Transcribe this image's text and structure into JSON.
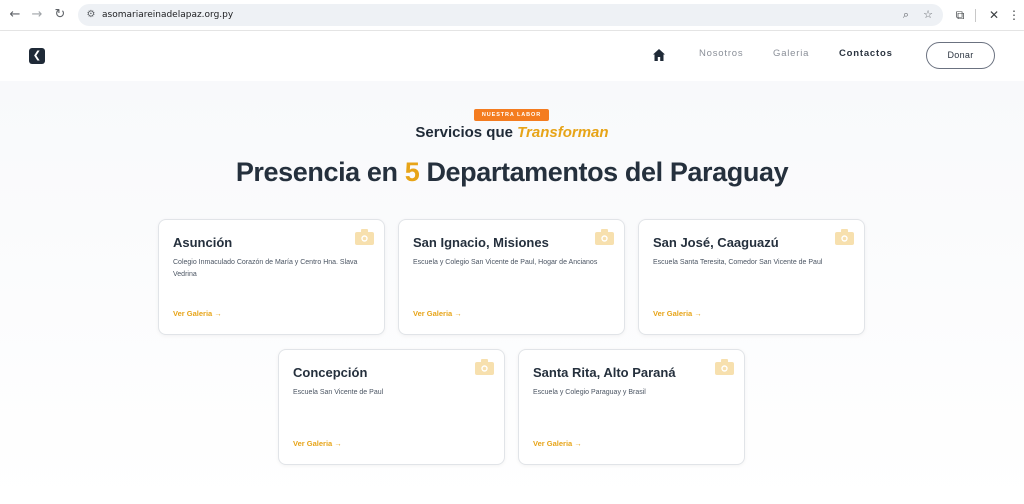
{
  "browser": {
    "url": "asomariareinadelapaz.org.py",
    "back_icon": "arrow-left-icon",
    "forward_icon": "arrow-right-icon",
    "reload_icon": "reload-icon"
  },
  "header": {
    "logo_glyph": "❮",
    "nav": {
      "nosotros": "Nosotros",
      "galeria": "Galeria",
      "contactos": "Contactos"
    },
    "donate_label": "Donar"
  },
  "section": {
    "badge": "NUESTRA LABOR",
    "subtitle_prefix": "Servicios que ",
    "subtitle_accent": "Transforman",
    "title_prefix": "Presencia en ",
    "title_number": "5",
    "title_suffix": " Departamentos del Paraguay"
  },
  "colors": {
    "accent": "#e7a418",
    "badge": "#f47c20",
    "dark": "#25303d"
  },
  "cards": [
    {
      "title": "Asunción",
      "description": "Colegio Inmaculado Corazón de María y Centro Hna. Slava Vedrina",
      "link": "Ver Galeria →"
    },
    {
      "title": "San Ignacio, Misiones",
      "description": "Escuela y Colegio San Vicente de Paul, Hogar de Ancianos",
      "link": "Ver Galeria →"
    },
    {
      "title": "San José, Caaguazú",
      "description": "Escuela Santa Teresita, Comedor San Vicente de Paul",
      "link": "Ver Galeria →"
    },
    {
      "title": "Concepción",
      "description": "Escuela San Vicente de Paul",
      "link": "Ver Galeria →"
    },
    {
      "title": "Santa Rita, Alto Paraná",
      "description": "Escuela y Colegio Paraguay y Brasil",
      "link": "Ver Galeria →"
    }
  ]
}
